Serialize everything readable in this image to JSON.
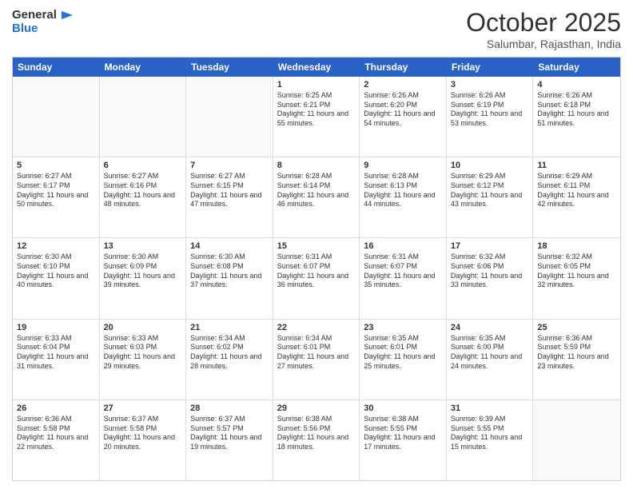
{
  "header": {
    "logo_line1": "General",
    "logo_line2": "Blue",
    "month": "October 2025",
    "location": "Salumbar, Rajasthan, India"
  },
  "days_of_week": [
    "Sunday",
    "Monday",
    "Tuesday",
    "Wednesday",
    "Thursday",
    "Friday",
    "Saturday"
  ],
  "weeks": [
    [
      {
        "day": "",
        "sunrise": "",
        "sunset": "",
        "daylight": ""
      },
      {
        "day": "",
        "sunrise": "",
        "sunset": "",
        "daylight": ""
      },
      {
        "day": "",
        "sunrise": "",
        "sunset": "",
        "daylight": ""
      },
      {
        "day": "1",
        "sunrise": "Sunrise: 6:25 AM",
        "sunset": "Sunset: 6:21 PM",
        "daylight": "Daylight: 11 hours and 55 minutes."
      },
      {
        "day": "2",
        "sunrise": "Sunrise: 6:26 AM",
        "sunset": "Sunset: 6:20 PM",
        "daylight": "Daylight: 11 hours and 54 minutes."
      },
      {
        "day": "3",
        "sunrise": "Sunrise: 6:26 AM",
        "sunset": "Sunset: 6:19 PM",
        "daylight": "Daylight: 11 hours and 53 minutes."
      },
      {
        "day": "4",
        "sunrise": "Sunrise: 6:26 AM",
        "sunset": "Sunset: 6:18 PM",
        "daylight": "Daylight: 11 hours and 51 minutes."
      }
    ],
    [
      {
        "day": "5",
        "sunrise": "Sunrise: 6:27 AM",
        "sunset": "Sunset: 6:17 PM",
        "daylight": "Daylight: 11 hours and 50 minutes."
      },
      {
        "day": "6",
        "sunrise": "Sunrise: 6:27 AM",
        "sunset": "Sunset: 6:16 PM",
        "daylight": "Daylight: 11 hours and 48 minutes."
      },
      {
        "day": "7",
        "sunrise": "Sunrise: 6:27 AM",
        "sunset": "Sunset: 6:15 PM",
        "daylight": "Daylight: 11 hours and 47 minutes."
      },
      {
        "day": "8",
        "sunrise": "Sunrise: 6:28 AM",
        "sunset": "Sunset: 6:14 PM",
        "daylight": "Daylight: 11 hours and 46 minutes."
      },
      {
        "day": "9",
        "sunrise": "Sunrise: 6:28 AM",
        "sunset": "Sunset: 6:13 PM",
        "daylight": "Daylight: 11 hours and 44 minutes."
      },
      {
        "day": "10",
        "sunrise": "Sunrise: 6:29 AM",
        "sunset": "Sunset: 6:12 PM",
        "daylight": "Daylight: 11 hours and 43 minutes."
      },
      {
        "day": "11",
        "sunrise": "Sunrise: 6:29 AM",
        "sunset": "Sunset: 6:11 PM",
        "daylight": "Daylight: 11 hours and 42 minutes."
      }
    ],
    [
      {
        "day": "12",
        "sunrise": "Sunrise: 6:30 AM",
        "sunset": "Sunset: 6:10 PM",
        "daylight": "Daylight: 11 hours and 40 minutes."
      },
      {
        "day": "13",
        "sunrise": "Sunrise: 6:30 AM",
        "sunset": "Sunset: 6:09 PM",
        "daylight": "Daylight: 11 hours and 39 minutes."
      },
      {
        "day": "14",
        "sunrise": "Sunrise: 6:30 AM",
        "sunset": "Sunset: 6:08 PM",
        "daylight": "Daylight: 11 hours and 37 minutes."
      },
      {
        "day": "15",
        "sunrise": "Sunrise: 6:31 AM",
        "sunset": "Sunset: 6:07 PM",
        "daylight": "Daylight: 11 hours and 36 minutes."
      },
      {
        "day": "16",
        "sunrise": "Sunrise: 6:31 AM",
        "sunset": "Sunset: 6:07 PM",
        "daylight": "Daylight: 11 hours and 35 minutes."
      },
      {
        "day": "17",
        "sunrise": "Sunrise: 6:32 AM",
        "sunset": "Sunset: 6:06 PM",
        "daylight": "Daylight: 11 hours and 33 minutes."
      },
      {
        "day": "18",
        "sunrise": "Sunrise: 6:32 AM",
        "sunset": "Sunset: 6:05 PM",
        "daylight": "Daylight: 11 hours and 32 minutes."
      }
    ],
    [
      {
        "day": "19",
        "sunrise": "Sunrise: 6:33 AM",
        "sunset": "Sunset: 6:04 PM",
        "daylight": "Daylight: 11 hours and 31 minutes."
      },
      {
        "day": "20",
        "sunrise": "Sunrise: 6:33 AM",
        "sunset": "Sunset: 6:03 PM",
        "daylight": "Daylight: 11 hours and 29 minutes."
      },
      {
        "day": "21",
        "sunrise": "Sunrise: 6:34 AM",
        "sunset": "Sunset: 6:02 PM",
        "daylight": "Daylight: 11 hours and 28 minutes."
      },
      {
        "day": "22",
        "sunrise": "Sunrise: 6:34 AM",
        "sunset": "Sunset: 6:01 PM",
        "daylight": "Daylight: 11 hours and 27 minutes."
      },
      {
        "day": "23",
        "sunrise": "Sunrise: 6:35 AM",
        "sunset": "Sunset: 6:01 PM",
        "daylight": "Daylight: 11 hours and 25 minutes."
      },
      {
        "day": "24",
        "sunrise": "Sunrise: 6:35 AM",
        "sunset": "Sunset: 6:00 PM",
        "daylight": "Daylight: 11 hours and 24 minutes."
      },
      {
        "day": "25",
        "sunrise": "Sunrise: 6:36 AM",
        "sunset": "Sunset: 5:59 PM",
        "daylight": "Daylight: 11 hours and 23 minutes."
      }
    ],
    [
      {
        "day": "26",
        "sunrise": "Sunrise: 6:36 AM",
        "sunset": "Sunset: 5:58 PM",
        "daylight": "Daylight: 11 hours and 22 minutes."
      },
      {
        "day": "27",
        "sunrise": "Sunrise: 6:37 AM",
        "sunset": "Sunset: 5:58 PM",
        "daylight": "Daylight: 11 hours and 20 minutes."
      },
      {
        "day": "28",
        "sunrise": "Sunrise: 6:37 AM",
        "sunset": "Sunset: 5:57 PM",
        "daylight": "Daylight: 11 hours and 19 minutes."
      },
      {
        "day": "29",
        "sunrise": "Sunrise: 6:38 AM",
        "sunset": "Sunset: 5:56 PM",
        "daylight": "Daylight: 11 hours and 18 minutes."
      },
      {
        "day": "30",
        "sunrise": "Sunrise: 6:38 AM",
        "sunset": "Sunset: 5:55 PM",
        "daylight": "Daylight: 11 hours and 17 minutes."
      },
      {
        "day": "31",
        "sunrise": "Sunrise: 6:39 AM",
        "sunset": "Sunset: 5:55 PM",
        "daylight": "Daylight: 11 hours and 15 minutes."
      },
      {
        "day": "",
        "sunrise": "",
        "sunset": "",
        "daylight": ""
      }
    ]
  ]
}
